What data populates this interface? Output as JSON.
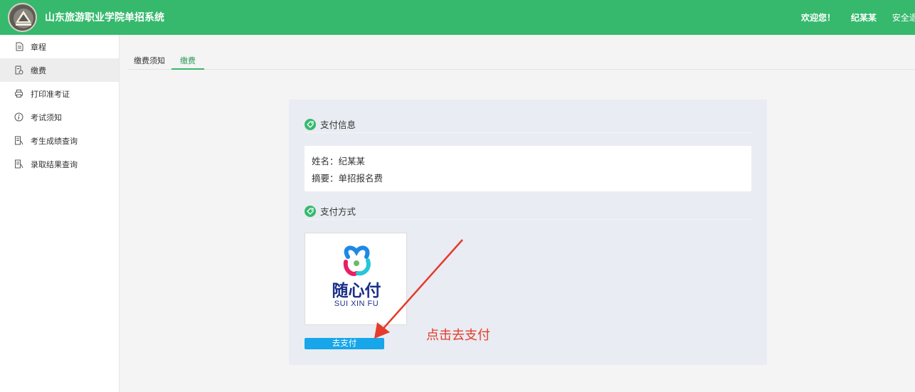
{
  "header": {
    "title": "山东旅游职业学院单招系统",
    "welcome": "欢迎您！",
    "user_name": "纪某某",
    "logout": "安全退出"
  },
  "sidebar": {
    "items": [
      {
        "label": "章程",
        "icon": "document-icon",
        "active": false
      },
      {
        "label": "缴费",
        "icon": "payment-icon",
        "active": true
      },
      {
        "label": "打印准考证",
        "icon": "printer-icon",
        "active": false
      },
      {
        "label": "考试须知",
        "icon": "info-icon",
        "active": false
      },
      {
        "label": "考生成绩查询",
        "icon": "report-icon",
        "active": false
      },
      {
        "label": "录取结果查询",
        "icon": "report-icon",
        "active": false
      }
    ]
  },
  "tabs": [
    {
      "label": "缴费须知",
      "active": false
    },
    {
      "label": "缴费",
      "active": true
    }
  ],
  "payment_info": {
    "section_title": "支付信息",
    "name_label": "姓名：纪某某",
    "summary_label": "摘要：单招报名费"
  },
  "payment_method": {
    "section_title": "支付方式",
    "logo_cn": "随心付",
    "logo_en": "SUI XIN FU",
    "pay_button": "去支付"
  },
  "annotation": {
    "text": "点击去支付"
  },
  "colors": {
    "header_green": "#36b96d",
    "pay_button_blue": "#16a6e9",
    "annotation_red": "#e53b2c"
  }
}
